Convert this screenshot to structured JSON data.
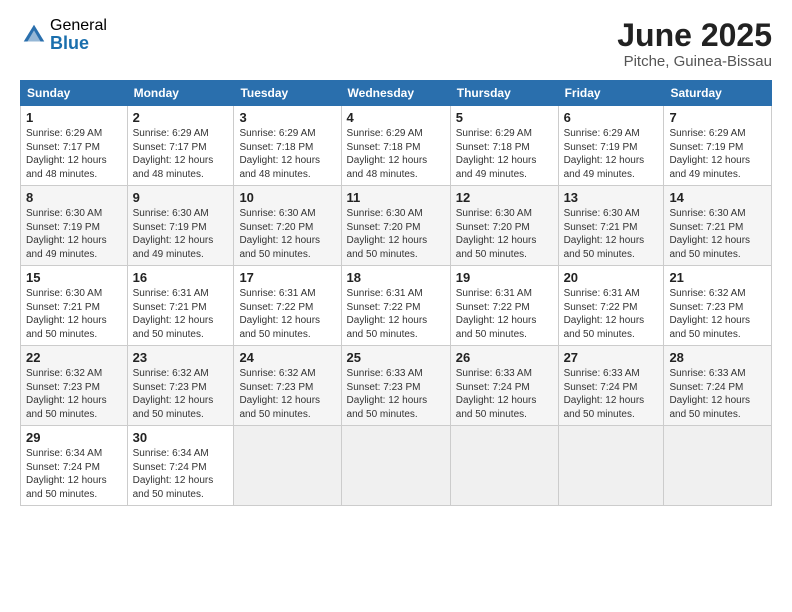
{
  "header": {
    "logo_general": "General",
    "logo_blue": "Blue",
    "month_title": "June 2025",
    "location": "Pitche, Guinea-Bissau"
  },
  "weekdays": [
    "Sunday",
    "Monday",
    "Tuesday",
    "Wednesday",
    "Thursday",
    "Friday",
    "Saturday"
  ],
  "weeks": [
    [
      {
        "day": "1",
        "info": "Sunrise: 6:29 AM\nSunset: 7:17 PM\nDaylight: 12 hours\nand 48 minutes."
      },
      {
        "day": "2",
        "info": "Sunrise: 6:29 AM\nSunset: 7:17 PM\nDaylight: 12 hours\nand 48 minutes."
      },
      {
        "day": "3",
        "info": "Sunrise: 6:29 AM\nSunset: 7:18 PM\nDaylight: 12 hours\nand 48 minutes."
      },
      {
        "day": "4",
        "info": "Sunrise: 6:29 AM\nSunset: 7:18 PM\nDaylight: 12 hours\nand 48 minutes."
      },
      {
        "day": "5",
        "info": "Sunrise: 6:29 AM\nSunset: 7:18 PM\nDaylight: 12 hours\nand 49 minutes."
      },
      {
        "day": "6",
        "info": "Sunrise: 6:29 AM\nSunset: 7:19 PM\nDaylight: 12 hours\nand 49 minutes."
      },
      {
        "day": "7",
        "info": "Sunrise: 6:29 AM\nSunset: 7:19 PM\nDaylight: 12 hours\nand 49 minutes."
      }
    ],
    [
      {
        "day": "8",
        "info": "Sunrise: 6:30 AM\nSunset: 7:19 PM\nDaylight: 12 hours\nand 49 minutes."
      },
      {
        "day": "9",
        "info": "Sunrise: 6:30 AM\nSunset: 7:19 PM\nDaylight: 12 hours\nand 49 minutes."
      },
      {
        "day": "10",
        "info": "Sunrise: 6:30 AM\nSunset: 7:20 PM\nDaylight: 12 hours\nand 50 minutes."
      },
      {
        "day": "11",
        "info": "Sunrise: 6:30 AM\nSunset: 7:20 PM\nDaylight: 12 hours\nand 50 minutes."
      },
      {
        "day": "12",
        "info": "Sunrise: 6:30 AM\nSunset: 7:20 PM\nDaylight: 12 hours\nand 50 minutes."
      },
      {
        "day": "13",
        "info": "Sunrise: 6:30 AM\nSunset: 7:21 PM\nDaylight: 12 hours\nand 50 minutes."
      },
      {
        "day": "14",
        "info": "Sunrise: 6:30 AM\nSunset: 7:21 PM\nDaylight: 12 hours\nand 50 minutes."
      }
    ],
    [
      {
        "day": "15",
        "info": "Sunrise: 6:30 AM\nSunset: 7:21 PM\nDaylight: 12 hours\nand 50 minutes."
      },
      {
        "day": "16",
        "info": "Sunrise: 6:31 AM\nSunset: 7:21 PM\nDaylight: 12 hours\nand 50 minutes."
      },
      {
        "day": "17",
        "info": "Sunrise: 6:31 AM\nSunset: 7:22 PM\nDaylight: 12 hours\nand 50 minutes."
      },
      {
        "day": "18",
        "info": "Sunrise: 6:31 AM\nSunset: 7:22 PM\nDaylight: 12 hours\nand 50 minutes."
      },
      {
        "day": "19",
        "info": "Sunrise: 6:31 AM\nSunset: 7:22 PM\nDaylight: 12 hours\nand 50 minutes."
      },
      {
        "day": "20",
        "info": "Sunrise: 6:31 AM\nSunset: 7:22 PM\nDaylight: 12 hours\nand 50 minutes."
      },
      {
        "day": "21",
        "info": "Sunrise: 6:32 AM\nSunset: 7:23 PM\nDaylight: 12 hours\nand 50 minutes."
      }
    ],
    [
      {
        "day": "22",
        "info": "Sunrise: 6:32 AM\nSunset: 7:23 PM\nDaylight: 12 hours\nand 50 minutes."
      },
      {
        "day": "23",
        "info": "Sunrise: 6:32 AM\nSunset: 7:23 PM\nDaylight: 12 hours\nand 50 minutes."
      },
      {
        "day": "24",
        "info": "Sunrise: 6:32 AM\nSunset: 7:23 PM\nDaylight: 12 hours\nand 50 minutes."
      },
      {
        "day": "25",
        "info": "Sunrise: 6:33 AM\nSunset: 7:23 PM\nDaylight: 12 hours\nand 50 minutes."
      },
      {
        "day": "26",
        "info": "Sunrise: 6:33 AM\nSunset: 7:24 PM\nDaylight: 12 hours\nand 50 minutes."
      },
      {
        "day": "27",
        "info": "Sunrise: 6:33 AM\nSunset: 7:24 PM\nDaylight: 12 hours\nand 50 minutes."
      },
      {
        "day": "28",
        "info": "Sunrise: 6:33 AM\nSunset: 7:24 PM\nDaylight: 12 hours\nand 50 minutes."
      }
    ],
    [
      {
        "day": "29",
        "info": "Sunrise: 6:34 AM\nSunset: 7:24 PM\nDaylight: 12 hours\nand 50 minutes."
      },
      {
        "day": "30",
        "info": "Sunrise: 6:34 AM\nSunset: 7:24 PM\nDaylight: 12 hours\nand 50 minutes."
      },
      {
        "day": "",
        "info": ""
      },
      {
        "day": "",
        "info": ""
      },
      {
        "day": "",
        "info": ""
      },
      {
        "day": "",
        "info": ""
      },
      {
        "day": "",
        "info": ""
      }
    ]
  ]
}
